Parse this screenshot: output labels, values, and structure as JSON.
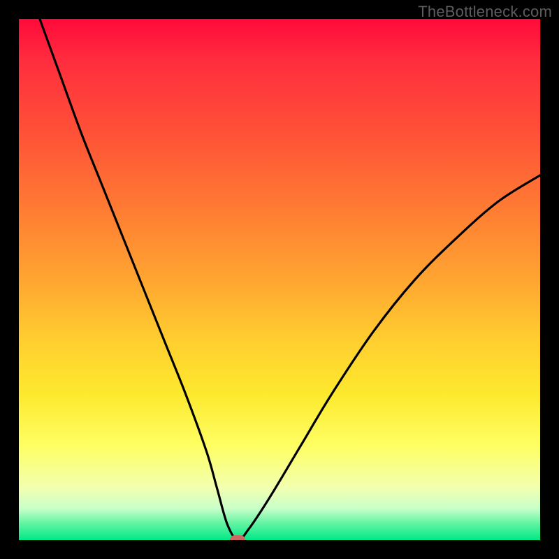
{
  "watermark": "TheBottleneck.com",
  "colors": {
    "frame": "#000000",
    "curve": "#000000",
    "marker": "#cc6a61",
    "gradient_stops": [
      "#ff0a3a",
      "#ff2d3e",
      "#ff5237",
      "#ff7a33",
      "#ffa531",
      "#ffcf2f",
      "#fde92e",
      "#feff64",
      "#f2ffb0",
      "#c7ffc9",
      "#5bf3a0",
      "#00e987"
    ]
  },
  "chart_data": {
    "type": "line",
    "title": "",
    "xlabel": "",
    "ylabel": "",
    "xlim": [
      0,
      100
    ],
    "ylim": [
      0,
      100
    ],
    "grid": false,
    "legend": false,
    "marker": {
      "x": 42,
      "y": 0
    },
    "series": [
      {
        "name": "bottleneck-curve",
        "x": [
          4,
          8,
          12,
          16,
          20,
          24,
          28,
          32,
          36,
          38,
          40,
          42,
          44,
          48,
          54,
          60,
          68,
          76,
          84,
          92,
          100
        ],
        "y": [
          100,
          89,
          78,
          68,
          58,
          48,
          38,
          28,
          17,
          10,
          3,
          0,
          2,
          8,
          18,
          28,
          40,
          50,
          58,
          65,
          70
        ]
      }
    ]
  }
}
